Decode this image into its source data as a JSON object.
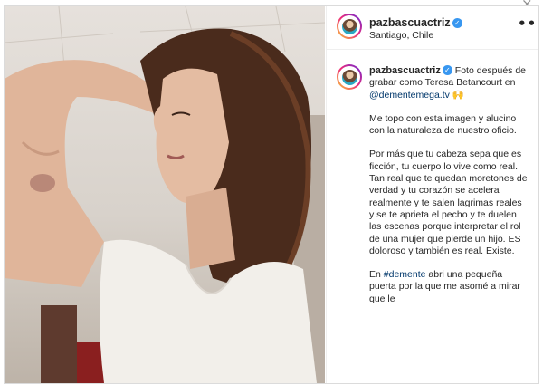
{
  "window": {
    "close_glyph": "×"
  },
  "post": {
    "username": "pazbascuactriz",
    "verified_glyph": "✓",
    "location": "Santiago, Chile",
    "more_glyph": "•••",
    "caption": {
      "intro": "Foto después de grabar como Teresa Betancourt en",
      "mention": "@dementemega.tv",
      "emoji": "🙌",
      "p2": "Me topo con esta imagen y alucino con la naturaleza de nuestro oficio.",
      "p3": "Por más que tu cabeza sepa que es ficción, tu cuerpo lo vive como real. Tan real que te quedan moretones de verdad y tu corazón se acelera realmente y te salen lagrimas reales y se te aprieta el pecho y te duelen las escenas porque interpretar el rol de una mujer que pierde un hijo. ES doloroso y también es real. Existe.",
      "p4_prefix": "En ",
      "hashtag": "#demente",
      "p4_rest": " abri una pequeña puerta por la que me asomé a mirar que le"
    }
  },
  "colors": {
    "verified": "#3897f0",
    "link": "#00376b",
    "text": "#262626",
    "border": "#dbdbdb"
  },
  "icons": [
    "close-icon",
    "verified-icon",
    "more-options-icon",
    "avatar"
  ]
}
